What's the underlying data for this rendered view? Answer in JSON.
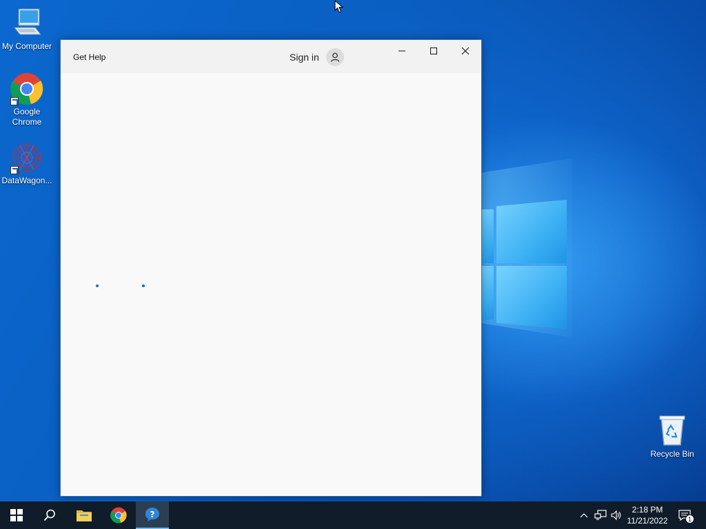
{
  "desktop": {
    "icons": [
      {
        "label": "My Computer",
        "icon": "computer-icon"
      },
      {
        "label": "Google Chrome",
        "icon": "chrome-icon"
      },
      {
        "label": "DataWagon...",
        "icon": "datawagon-icon"
      },
      {
        "label": "Recycle Bin",
        "icon": "recycle-bin-icon"
      }
    ]
  },
  "window": {
    "title": "Get Help",
    "sign_in_label": "Sign in",
    "controls": [
      "minimize",
      "maximize",
      "close"
    ],
    "state": "loading"
  },
  "taskbar": {
    "items": [
      {
        "name": "Start",
        "icon": "windows-start-icon"
      },
      {
        "name": "Search",
        "icon": "search-icon"
      },
      {
        "name": "File Explorer",
        "icon": "folder-icon"
      },
      {
        "name": "Google Chrome",
        "icon": "chrome-icon"
      },
      {
        "name": "Get Help",
        "icon": "get-help-icon",
        "active": true
      }
    ],
    "time": "2:18 PM",
    "date": "11/21/2022",
    "notification_count": "1"
  },
  "colors": {
    "accent": "#0078d7",
    "taskbar": "#101c2a",
    "window_bg": "#f8f8f8"
  }
}
